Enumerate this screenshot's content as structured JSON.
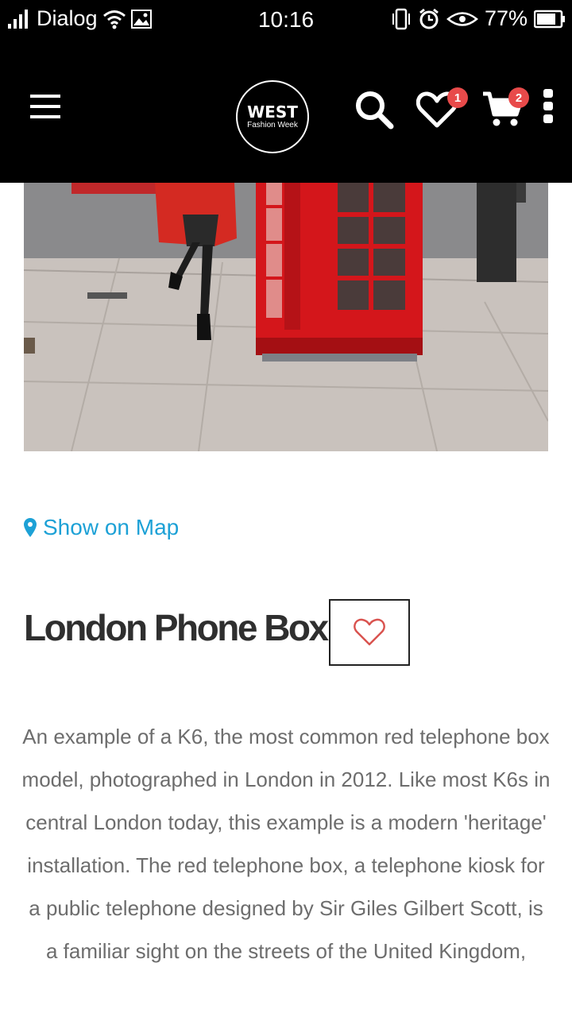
{
  "status_bar": {
    "carrier": "Dialog",
    "time": "10:16",
    "battery": "77%"
  },
  "header": {
    "logo_title": "WEST",
    "logo_subtitle": "Fashion Week",
    "wishlist_count": "1",
    "cart_count": "2"
  },
  "hero": {
    "image_subject": "red telephone box on London street"
  },
  "location": {
    "map_link_label": "Show on Map"
  },
  "place": {
    "title": "London Phone Box",
    "description": "An example of a K6, the most common red telephone box model, photographed in London in 2012. Like most K6s in central London today, this example is a modern 'heritage' installation. The red telephone box, a telephone kiosk for a public telephone designed by Sir Giles Gilbert Scott, is a familiar sight on the streets of the United Kingdom,"
  },
  "colors": {
    "header_bg": "#000000",
    "accent_link": "#1da1d6",
    "badge": "#e84a4a",
    "heart": "#d9534f"
  }
}
